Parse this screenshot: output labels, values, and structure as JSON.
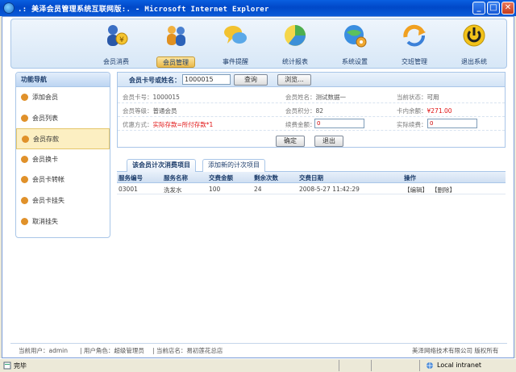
{
  "window": {
    "title": ".: 美泽会员管理系统互联网版:. - Microsoft Internet Explorer",
    "min": "_",
    "max": "□",
    "close": "✕"
  },
  "topnav": {
    "items": [
      {
        "label": "会员消费",
        "icon": "coin-user-icon"
      },
      {
        "label": "会员管理",
        "icon": "users-icon",
        "active": true
      },
      {
        "label": "事件提醒",
        "icon": "chat-bubble-icon"
      },
      {
        "label": "统计报表",
        "icon": "pie-chart-icon"
      },
      {
        "label": "系统设置",
        "icon": "globe-gear-icon"
      },
      {
        "label": "交班管理",
        "icon": "refresh-arrow-icon"
      },
      {
        "label": "退出系统",
        "icon": "power-icon"
      }
    ]
  },
  "leftnav": {
    "title": "功能导航",
    "items": [
      {
        "label": "添加会员"
      },
      {
        "label": "会员列表"
      },
      {
        "label": "会员存款",
        "active": true
      },
      {
        "label": "会员换卡"
      },
      {
        "label": "会员卡转帐"
      },
      {
        "label": "会员卡挂失"
      },
      {
        "label": "取消挂失"
      }
    ]
  },
  "query": {
    "label": "会员卡号或姓名：",
    "value": "1000015",
    "search_button": "查询",
    "browse_button": "浏览..."
  },
  "details": {
    "card_no_label": "会员卡号：",
    "card_no": "1000015",
    "name_label": "会员姓名：",
    "name": "测试数据一",
    "status_label": "当前状态：",
    "status": "可用",
    "level_label": "会员等级：",
    "level": "普通会员",
    "points_label": "会员积分：",
    "points": "82",
    "balance_label": "卡内余额：",
    "balance": "¥271.00",
    "promo_label": "优惠方式：",
    "promo": "实际存款=所付存款*1",
    "deposit_label": "续费金额：",
    "deposit_value": "0",
    "actual_label": "实际续费：",
    "actual_value": "0",
    "ok_button": "确定",
    "exit_button": "退出"
  },
  "tabs": [
    {
      "label": "该会员计次消费项目",
      "active": true
    },
    {
      "label": "添加新的计次项目"
    }
  ],
  "table": {
    "headers": [
      "服务编号",
      "服务名称",
      "交费金额",
      "剩余次数",
      "交费日期",
      "操作"
    ],
    "rows": [
      {
        "id": "03001",
        "name": "洗发水",
        "amount": "100",
        "remaining": "24",
        "date": "2008-5-27 11:42:29",
        "edit": "【编辑】",
        "delete": "【删除】"
      }
    ]
  },
  "footer": {
    "user": "当前用户：admin",
    "role": "| 用户角色：超级管理员",
    "store": "| 当前店名：易初莲花总店",
    "copyright": "美泽网络技术有限公司 版权所有"
  },
  "statusbar": {
    "left": "完毕",
    "zone": "Local intranet"
  }
}
